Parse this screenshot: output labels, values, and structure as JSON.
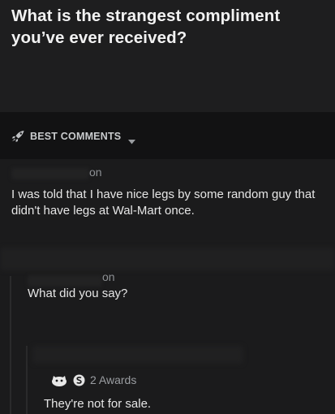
{
  "post": {
    "title": "What is the strangest compliment you’ve ever received?"
  },
  "sort": {
    "label": "BEST COMMENTS"
  },
  "comments": [
    {
      "username_fragment": "on",
      "text": "I was told that I have nice legs by some random guy that didn't have legs at Wal-Mart once."
    },
    {
      "username_fragment": "on",
      "text": "What did you say?"
    },
    {
      "awards_label": "2 Awards",
      "text": "They're not for sale."
    }
  ],
  "icons": {
    "sort": "rocket-icon",
    "sort_dropdown": "caret-down-icon",
    "award": "award-icon",
    "silver": "silver-award-icon"
  }
}
